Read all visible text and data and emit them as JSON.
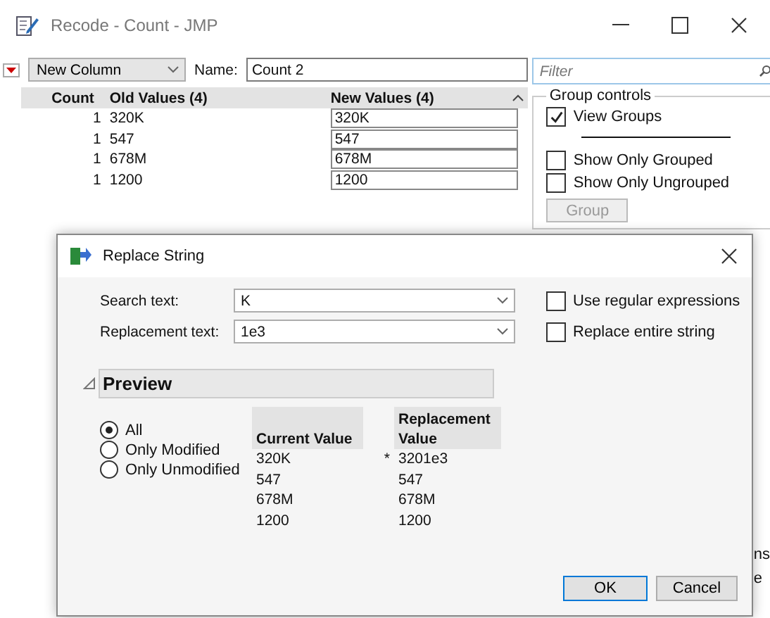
{
  "window": {
    "title": "Recode - Count - JMP"
  },
  "toolbar": {
    "mode": "New Column",
    "name_label": "Name:",
    "name_value": "Count 2",
    "filter_placeholder": "Filter"
  },
  "table": {
    "columns": [
      "Count",
      "Old Values (4)",
      "New Values (4)"
    ],
    "rows": [
      {
        "count": "1",
        "old": "320K",
        "new": "320K"
      },
      {
        "count": "1",
        "old": "547",
        "new": "547"
      },
      {
        "count": "1",
        "old": "678M",
        "new": "678M"
      },
      {
        "count": "1",
        "old": "1200",
        "new": "1200"
      }
    ]
  },
  "group_controls": {
    "title": "Group controls",
    "options": [
      {
        "label": "View Groups",
        "checked": true
      },
      {
        "label": "Show Only Grouped",
        "checked": false
      },
      {
        "label": "Show Only Ungrouped",
        "checked": false
      }
    ],
    "button": {
      "label": "Group",
      "disabled": true
    }
  },
  "side_fragments": [
    "ns",
    "e"
  ],
  "dialog": {
    "title": "Replace String",
    "fields": [
      {
        "label": "Search text:",
        "value": "K"
      },
      {
        "label": "Replacement text:",
        "value": "1e3"
      }
    ],
    "options": [
      {
        "label": "Use regular expressions",
        "checked": false
      },
      {
        "label": "Replace entire string",
        "checked": false
      }
    ],
    "preview": {
      "title": "Preview",
      "expanded": true,
      "filters": [
        {
          "label": "All",
          "selected": true
        },
        {
          "label": "Only Modified",
          "selected": false
        },
        {
          "label": "Only Unmodified",
          "selected": false
        }
      ],
      "columns": [
        "Current Value",
        "Replacement Value"
      ],
      "rows": [
        {
          "current": "320K",
          "marker": "*",
          "replacement": "3201e3"
        },
        {
          "current": "547",
          "replacement": "547"
        },
        {
          "current": "678M",
          "replacement": "678M"
        },
        {
          "current": "1200",
          "replacement": "1200"
        }
      ]
    },
    "buttons": [
      {
        "label": "OK",
        "default": true
      },
      {
        "label": "Cancel",
        "default": false
      }
    ]
  }
}
